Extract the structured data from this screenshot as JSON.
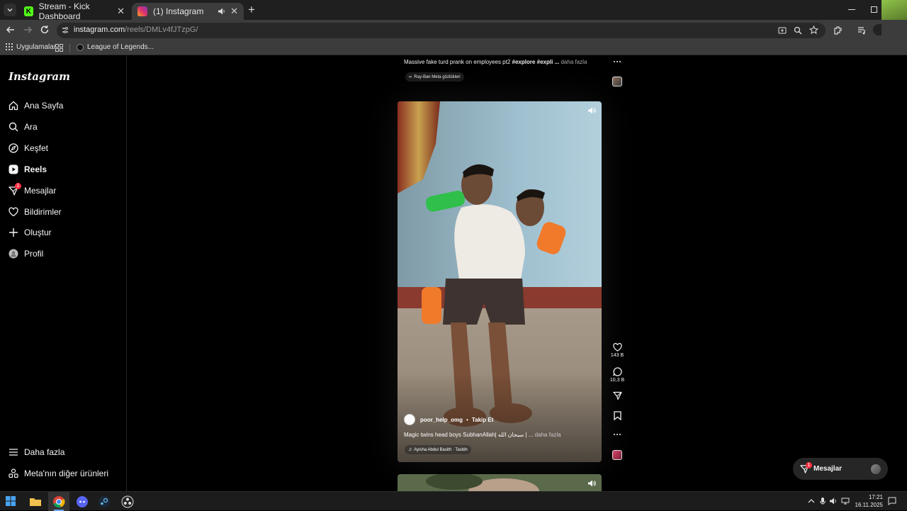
{
  "browser": {
    "tabs": [
      {
        "title": "Stream - Kick Dashboard",
        "active": false
      },
      {
        "title": "(1) Instagram",
        "active": true
      }
    ],
    "url_host": "instagram.com",
    "url_path": "/reels/DMLv4fJTzpG/",
    "bookmarks": [
      {
        "label": "Uygulamalar"
      },
      {
        "label": "League of Legends..."
      }
    ]
  },
  "instagram": {
    "logo": "Instagram",
    "nav": [
      {
        "label": "Ana Sayfa",
        "icon": "home-icon"
      },
      {
        "label": "Ara",
        "icon": "search-icon"
      },
      {
        "label": "Keşfet",
        "icon": "compass-icon"
      },
      {
        "label": "Reels",
        "icon": "reels-icon",
        "active": true
      },
      {
        "label": "Mesajlar",
        "icon": "messenger-icon",
        "badge": "1"
      },
      {
        "label": "Bildirimler",
        "icon": "heart-icon"
      },
      {
        "label": "Oluştur",
        "icon": "plus-icon"
      },
      {
        "label": "Profil",
        "icon": "avatar-icon"
      }
    ],
    "bottom_nav": [
      {
        "label": "Daha fazla",
        "icon": "menu-icon"
      },
      {
        "label": "Meta'nın diğer ürünleri",
        "icon": "meta-products-icon"
      }
    ],
    "prev_reel": {
      "caption_plain": "Massive fake turd prank on employees pt2 ",
      "caption_tags": "#explore #expl",
      "caption_ellipsis": "i ... ",
      "more": "daha fazla",
      "tag_chip": "Ray-Ban Meta gözlükleri"
    },
    "reel": {
      "username": "poor_help_omg",
      "separator": "•",
      "follow": "Takip Et",
      "caption": "Magic twins head boys SubhanAllah| سبحان الله | ... ",
      "more": "daha fazla",
      "audio": "Ayisha Abdul Basith · Tasbih",
      "likes": "143 B",
      "comments": "10,3 B"
    },
    "messages_pill": {
      "label": "Mesajlar",
      "badge": "1"
    }
  },
  "taskbar": {
    "time": "17:21",
    "date": "16.11.2025"
  }
}
